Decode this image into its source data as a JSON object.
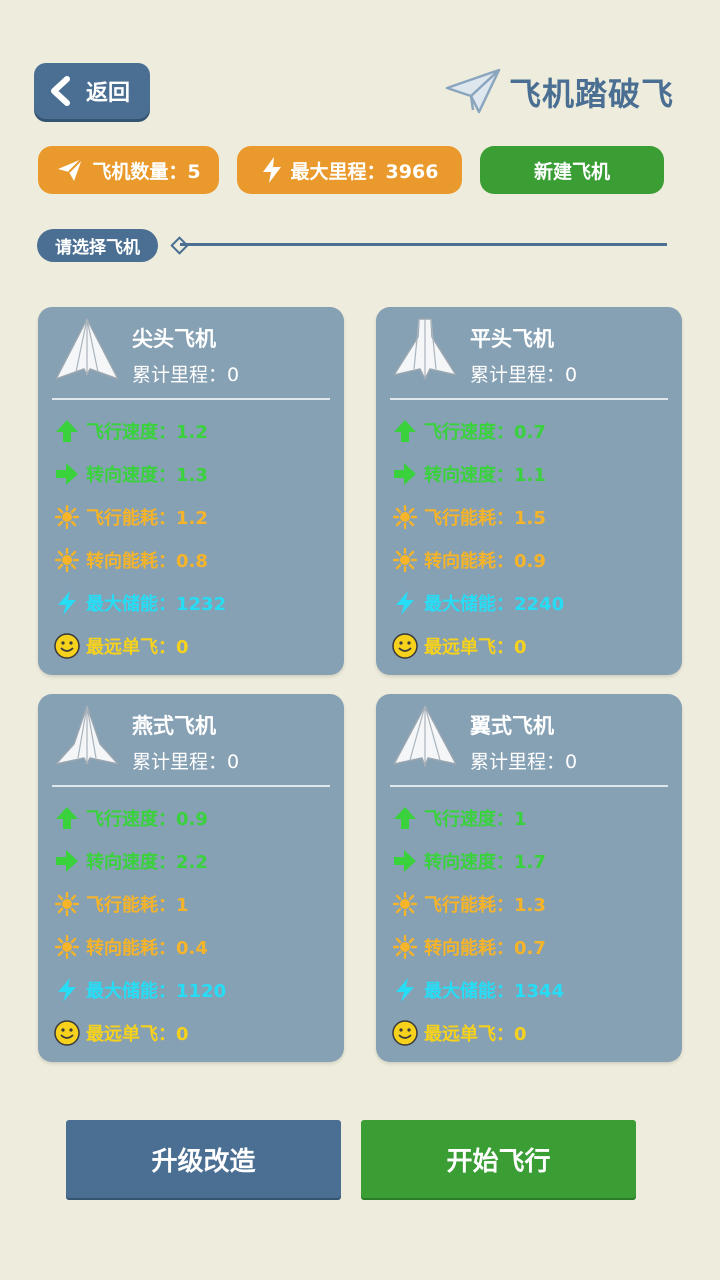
{
  "header": {
    "back_label": "返回",
    "title": "飞机踏破飞"
  },
  "stats_bar": {
    "plane_count_label": "飞机数量：5",
    "max_distance_label": "最大里程：3966",
    "new_plane_label": "新建飞机"
  },
  "section": {
    "label": "请选择飞机"
  },
  "planes": [
    {
      "name": "尖头飞机",
      "distance": "累计里程：0",
      "stats": {
        "fly_speed": "飞行速度：1.2",
        "turn_speed": "转向速度：1.3",
        "fly_energy": "飞行能耗：1.2",
        "turn_energy": "转向能耗：0.8",
        "max_storage": "最大储能：1232",
        "farthest": "最远单飞：0"
      }
    },
    {
      "name": "平头飞机",
      "distance": "累计里程：0",
      "stats": {
        "fly_speed": "飞行速度：0.7",
        "turn_speed": "转向速度：1.1",
        "fly_energy": "飞行能耗：1.5",
        "turn_energy": "转向能耗：0.9",
        "max_storage": "最大储能：2240",
        "farthest": "最远单飞：0"
      }
    },
    {
      "name": "燕式飞机",
      "distance": "累计里程：0",
      "stats": {
        "fly_speed": "飞行速度：0.9",
        "turn_speed": "转向速度：2.2",
        "fly_energy": "飞行能耗：1",
        "turn_energy": "转向能耗：0.4",
        "max_storage": "最大储能：1120",
        "farthest": "最远单飞：0"
      }
    },
    {
      "name": "翼式飞机",
      "distance": "累计里程：0",
      "stats": {
        "fly_speed": "飞行速度：1",
        "turn_speed": "转向速度：1.7",
        "fly_energy": "飞行能耗：1.3",
        "turn_energy": "转向能耗：0.7",
        "max_storage": "最大储能：1344",
        "farthest": "最远单飞：0"
      }
    }
  ],
  "footer": {
    "upgrade_label": "升级改造",
    "start_label": "开始飞行"
  },
  "colors": {
    "background": "#eeecdc",
    "primary_blue": "#4a6f93",
    "card": "#86a0b4",
    "orange": "#ea9a2c",
    "green_button": "#3a9e35",
    "stat_green": "#39d23c",
    "stat_yellow": "#f5b42a",
    "stat_cyan": "#27ddf5",
    "stat_gold": "#f7d21c"
  },
  "icons": [
    "back-arrow-icon",
    "paper-plane-logo-icon",
    "send-icon",
    "lightning-icon",
    "arrow-up-icon",
    "arrow-right-icon",
    "sun-icon",
    "smiley-icon"
  ]
}
